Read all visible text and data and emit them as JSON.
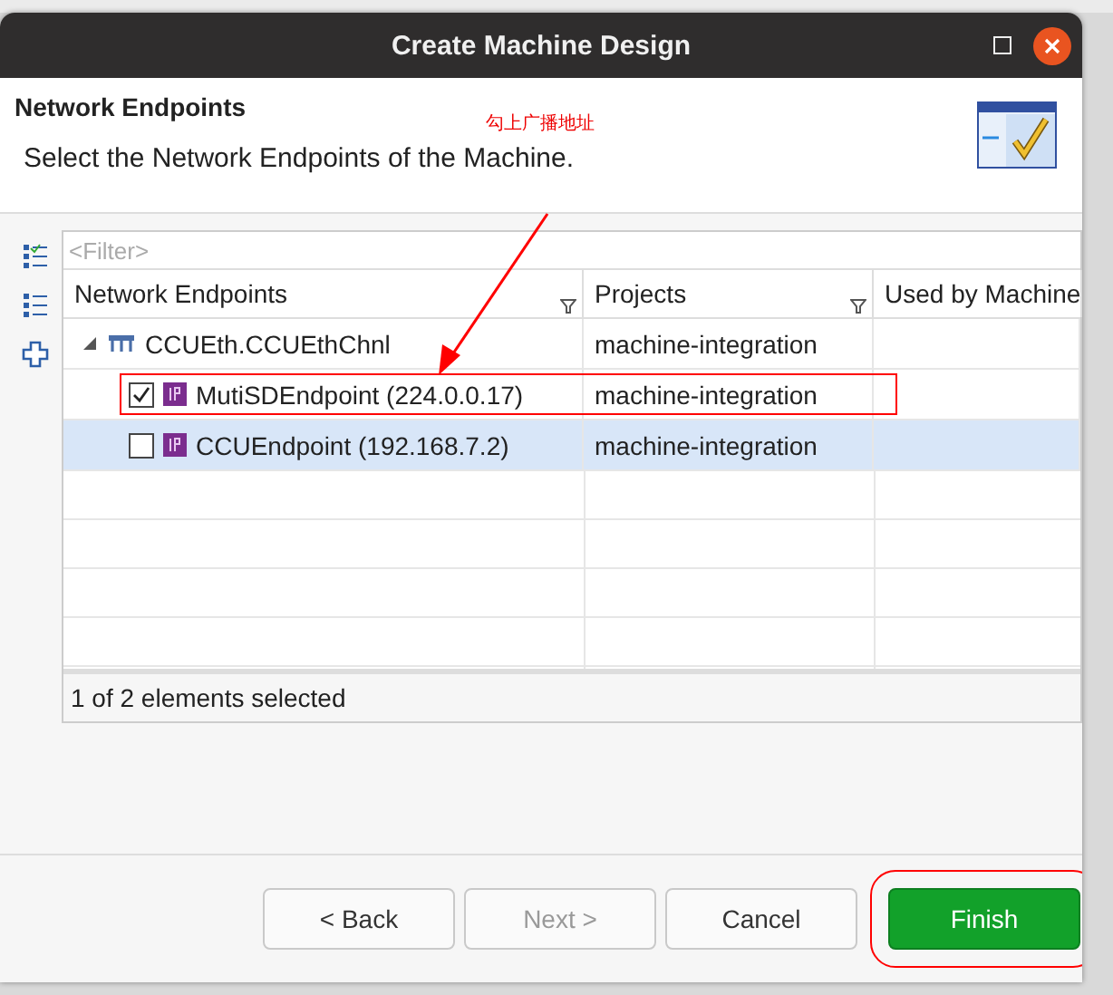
{
  "window": {
    "title": "Create Machine Design"
  },
  "header": {
    "title": "Network Endpoints",
    "description": "Select the Network Endpoints of the Machine."
  },
  "annotation": {
    "text": "勾上广播地址"
  },
  "filter": {
    "placeholder": "<Filter>"
  },
  "table": {
    "columns": [
      {
        "label": "Network Endpoints",
        "filter": true
      },
      {
        "label": "Projects",
        "filter": true
      },
      {
        "label": "Used by Machine",
        "filter": false
      }
    ],
    "rows": [
      {
        "kind": "group",
        "name": "CCUEth.CCUEthChnl",
        "project": "machine-integration",
        "expanded": true,
        "selected": false,
        "children": [
          {
            "kind": "endpoint",
            "name": "MutiSDEndpoint (224.0.0.17)",
            "project": "machine-integration",
            "checked": true,
            "selected": false,
            "highlighted": true
          },
          {
            "kind": "endpoint",
            "name": "CCUEndpoint (192.168.7.2)",
            "project": "machine-integration",
            "checked": false,
            "selected": true,
            "highlighted": false
          }
        ]
      }
    ]
  },
  "status": "1 of 2 elements selected",
  "buttons": [
    {
      "label": "< Back",
      "disabled": false,
      "primary": false,
      "highlighted": false
    },
    {
      "label": "Next >",
      "disabled": true,
      "primary": false,
      "highlighted": false
    },
    {
      "label": "Cancel",
      "disabled": false,
      "primary": false,
      "highlighted": false
    },
    {
      "label": "Finish",
      "disabled": false,
      "primary": true,
      "highlighted": true
    }
  ]
}
